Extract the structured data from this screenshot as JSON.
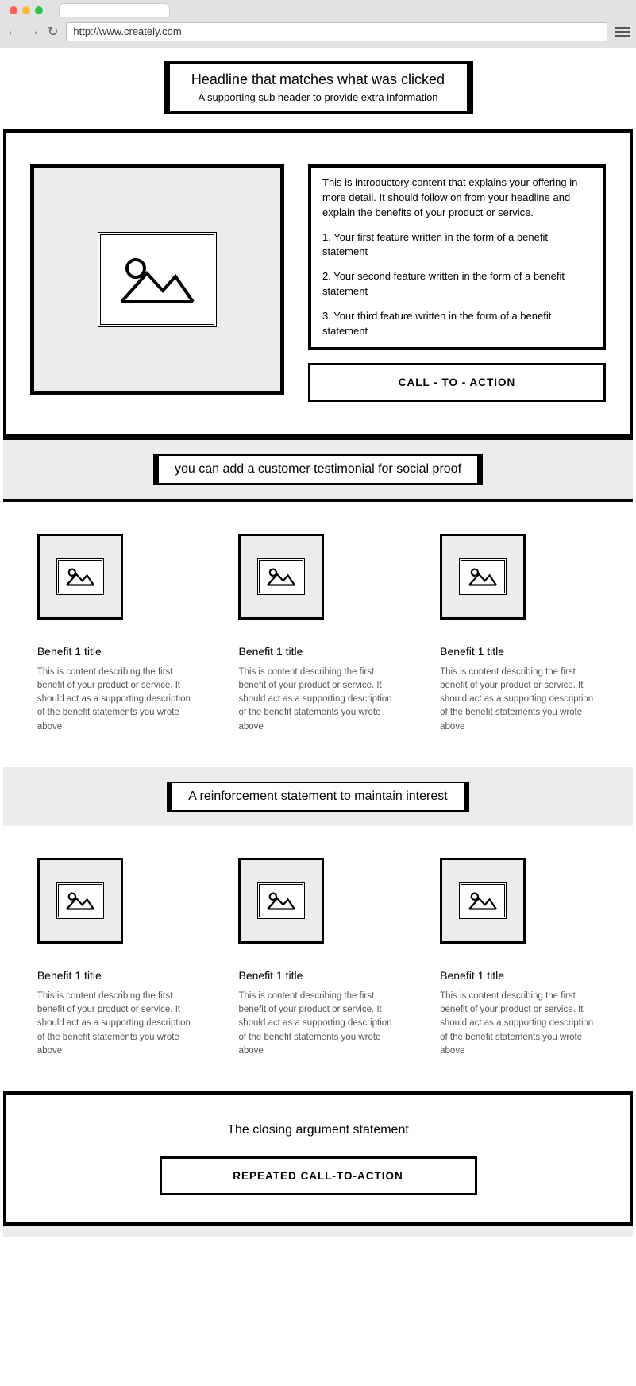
{
  "browser": {
    "url": "http://www.creately.com"
  },
  "headline": {
    "title": "Headline that matches what was clicked",
    "subtitle": "A supporting sub header to provide extra information"
  },
  "hero": {
    "intro": "This is introductory content that explains your offering in more detail. It should follow on from your headline and explain the benefits of your product or service.",
    "feature1": "1. Your first feature written in the form of a benefit statement",
    "feature2": "2. Your second feature written in the form of a benefit statement",
    "feature3": "3. Your third feature written in the form of a benefit statement",
    "cta_label": "CALL - TO - ACTION"
  },
  "testimonial": {
    "text": "you can add a customer testimonial for social proof"
  },
  "benefits_top": [
    {
      "title": "Benefit 1 title",
      "body": "This is content describing the first benefit of your product or service. It should act as a supporting description of the benefit statements you wrote above"
    },
    {
      "title": "Benefit 1 title",
      "body": "This is content describing the first benefit of your product or service. It should act as a supporting description of the benefit statements you wrote above"
    },
    {
      "title": "Benefit 1 title",
      "body": "This is content describing the first benefit of your product or service. It should act as a supporting description of the benefit statements you wrote above"
    }
  ],
  "reinforcement": {
    "text": "A reinforcement statement to maintain interest"
  },
  "benefits_bottom": [
    {
      "title": "Benefit 1 title",
      "body": "This is content describing the first benefit of your product or service. It should act as a supporting description of the benefit statements you wrote above"
    },
    {
      "title": "Benefit 1 title",
      "body": "This is content describing the first benefit of your product or service. It should act as a supporting description of the benefit statements you wrote above"
    },
    {
      "title": "Benefit 1 title",
      "body": "This is content describing the first benefit of your product or service. It should act as a supporting description of the benefit statements you wrote above"
    }
  ],
  "closing": {
    "statement": "The closing argument statement",
    "cta_label": "REPEATED CALL-TO-ACTION"
  }
}
